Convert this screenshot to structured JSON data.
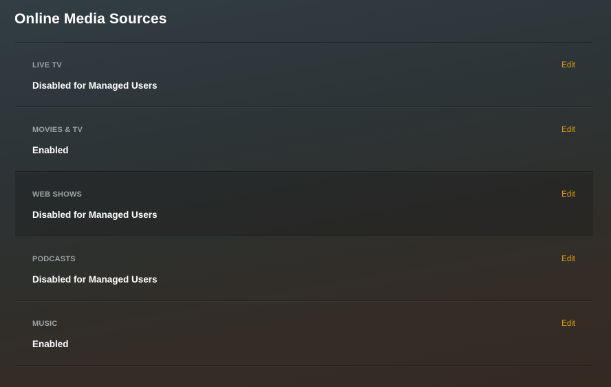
{
  "page": {
    "title": "Online Media Sources"
  },
  "sources": [
    {
      "name": "LIVE TV",
      "status": "Disabled for Managed Users",
      "edit_label": "Edit"
    },
    {
      "name": "MOVIES & TV",
      "status": "Enabled",
      "edit_label": "Edit"
    },
    {
      "name": "WEB SHOWS",
      "status": "Disabled for Managed Users",
      "edit_label": "Edit"
    },
    {
      "name": "PODCASTS",
      "status": "Disabled for Managed Users",
      "edit_label": "Edit"
    },
    {
      "name": "MUSIC",
      "status": "Enabled",
      "edit_label": "Edit"
    }
  ],
  "colors": {
    "accent": "#e5a00d",
    "label": "#9ea3a5",
    "text": "#ffffff"
  }
}
